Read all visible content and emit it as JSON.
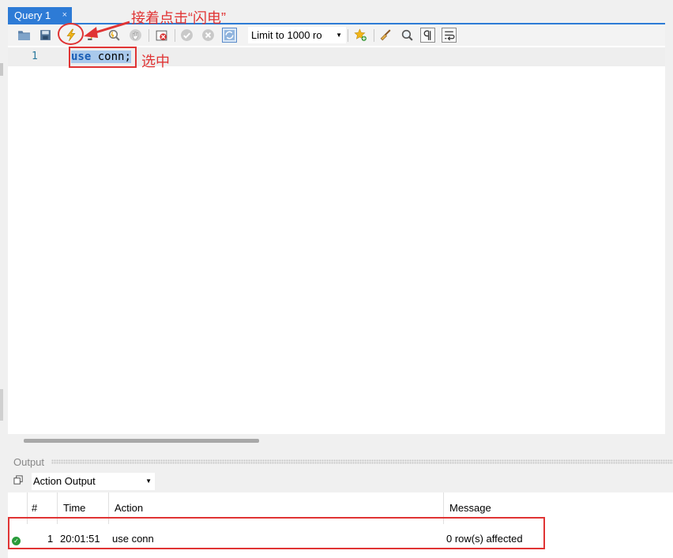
{
  "tab": {
    "label": "Query 1",
    "close": "×"
  },
  "toolbar": {
    "limit_select": "Limit to 1000 ro",
    "icons": [
      "open-folder",
      "save",
      "execute-lightning",
      "execute-statement",
      "explain",
      "stop",
      "toggle-error",
      "commit",
      "rollback",
      "autocommit",
      "beautify",
      "find",
      "invisible-chars",
      "wrap"
    ]
  },
  "editor": {
    "line_number": "1",
    "code_keyword": "use",
    "code_rest": " conn;"
  },
  "output": {
    "title": "Output",
    "select_value": "Action Output",
    "columns": [
      "#",
      "Time",
      "Action",
      "Message"
    ],
    "rows": [
      {
        "index": "1",
        "time": "20:01:51",
        "action": "use conn",
        "message": "0 row(s) affected",
        "status": "success"
      }
    ]
  },
  "annotations": {
    "click_lightning": "接着点击“闪电”",
    "select_text": "选中"
  },
  "colors": {
    "accent": "#2d7bd6",
    "annotation_red": "#e03434",
    "success": "#2a9b3a"
  }
}
